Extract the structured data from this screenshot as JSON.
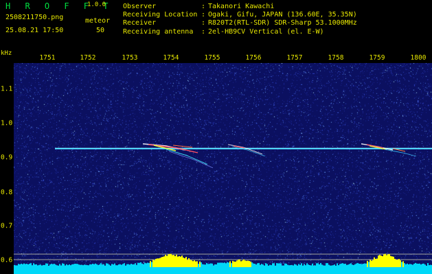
{
  "app": {
    "title": "H R O F F T",
    "version": "1.0.0"
  },
  "left_info": {
    "filename": "2508211750.png",
    "detection_kind": "meteor",
    "datetime": "25.08.21 17:50",
    "count": "50"
  },
  "info": [
    {
      "key": "Observer",
      "value": "Takanori Kawachi"
    },
    {
      "key": "Receiving Location",
      "value": "Ogaki, Gifu, JAPAN (136.60E, 35.35N)"
    },
    {
      "key": "Receiver",
      "value": "R820T2(RTL-SDR) SDR-Sharp 53.1000MHz"
    },
    {
      "key": "Receiving antenna",
      "value": "2el-HB9CV Vertical (el. E-W)"
    }
  ],
  "colors": {
    "text": "#e8e800",
    "title": "#00e040",
    "background": "#0b1060",
    "carrier": "#40d0ff",
    "hist_cyan": "#00d8f8",
    "hist_yellow": "#ffff00"
  },
  "chart_data": {
    "type": "heatmap",
    "y_unit": "kHz",
    "x_ticks": [
      "1751",
      "1752",
      "1753",
      "1754",
      "1755",
      "1756",
      "1757",
      "1758",
      "1759",
      "1800"
    ],
    "y_ticks": [
      "1.1",
      "1.0",
      "0.9",
      "0.8",
      "0.7",
      "0.6"
    ],
    "carrier_khz": 0.925,
    "meteor_echoes_approx_time": [
      "17:54",
      "17:56",
      "17:59"
    ]
  }
}
